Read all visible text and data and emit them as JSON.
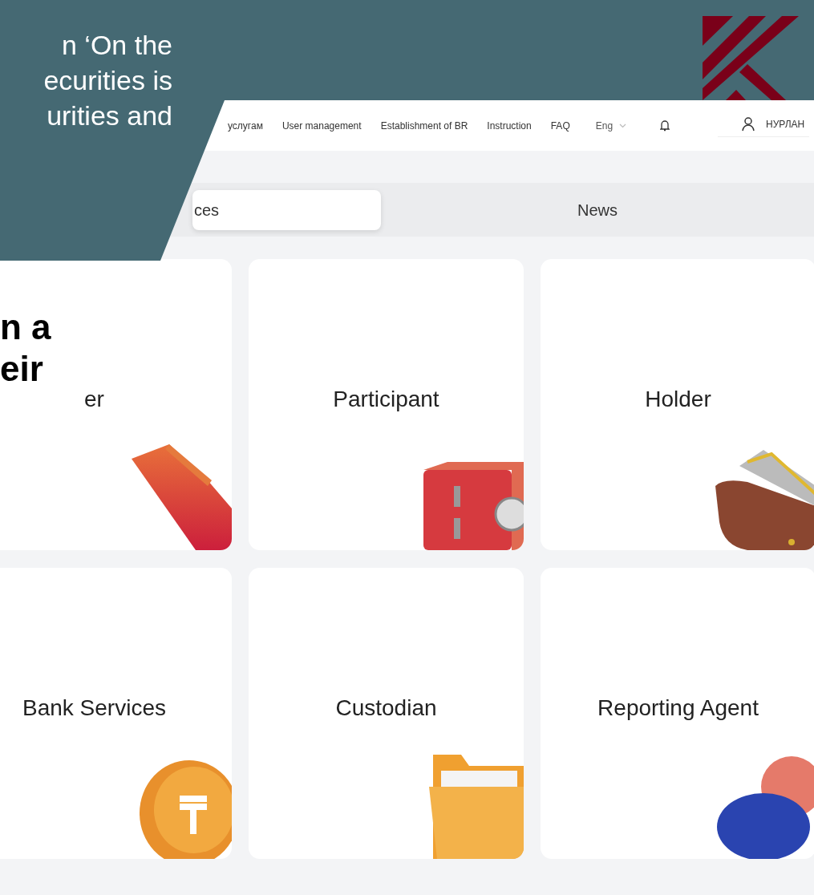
{
  "slide": {
    "text_lines": [
      "n ‘On the",
      "ecurities is",
      "urities and"
    ],
    "bold_lines": [
      "n a",
      "eir"
    ]
  },
  "navbar": {
    "items": [
      "услугам",
      "User management",
      "Establishment of BR",
      "Instruction",
      "FAQ"
    ],
    "language": "Eng",
    "user": "НУРЛАН"
  },
  "tabs": [
    {
      "label": "ces",
      "selected": true
    },
    {
      "label": "News",
      "selected": false
    }
  ],
  "cards": [
    {
      "title": "er",
      "kind": "document"
    },
    {
      "title": "Participant",
      "kind": "safe"
    },
    {
      "title": "Holder",
      "kind": "wallet"
    },
    {
      "title": "Bank Services",
      "kind": "coin"
    },
    {
      "title": "Custodian",
      "kind": "folder"
    },
    {
      "title": "Reporting Agent",
      "kind": "spheres"
    }
  ]
}
